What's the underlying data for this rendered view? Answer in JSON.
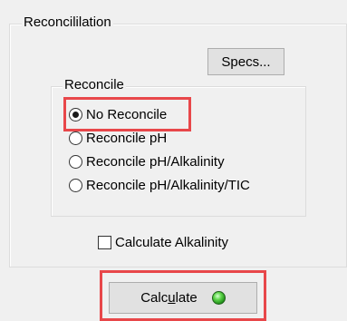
{
  "reconciliation_group": {
    "title": "Reconcililation"
  },
  "specs_button": {
    "label": "Specs..."
  },
  "reconcile_group": {
    "title": "Reconcile",
    "options": [
      {
        "label": "No Reconcile",
        "checked": true
      },
      {
        "label": "Reconcile pH",
        "checked": false
      },
      {
        "label": "Reconcile pH/Alkalinity",
        "checked": false
      },
      {
        "label": "Reconcile pH/Alkalinity/TIC",
        "checked": false
      }
    ]
  },
  "calculate_alkalinity": {
    "label": "Calculate Alkalinity",
    "checked": false
  },
  "calculate_button": {
    "label_pre": "Calc",
    "label_accel": "u",
    "label_post": "late",
    "status_icon": "green-led-icon"
  },
  "colors": {
    "highlight": "#e8474a",
    "background": "#f0f0f0",
    "led": "#3cc43a"
  }
}
